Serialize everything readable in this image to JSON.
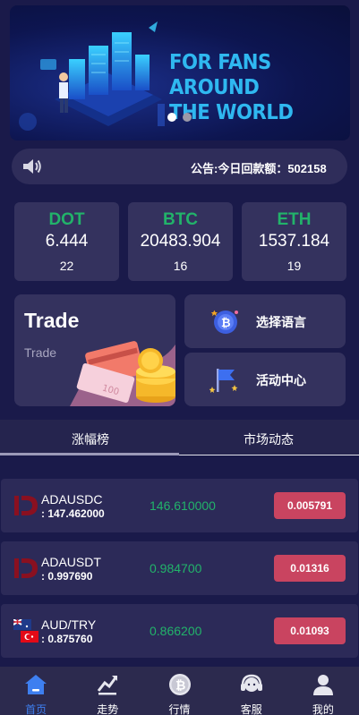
{
  "banner": {
    "title_line1": "FOR FANS AROUND",
    "title_line2": "THE WORLD",
    "slides": 2,
    "active_slide": 1
  },
  "notice": {
    "text": "公告:今日回款额：502158"
  },
  "tickers": [
    {
      "symbol": "DOT",
      "price": "6.444",
      "count": "22"
    },
    {
      "symbol": "BTC",
      "price": "20483.904",
      "count": "16"
    },
    {
      "symbol": "ETH",
      "price": "1537.184",
      "count": "19"
    }
  ],
  "trade": {
    "title": "Trade",
    "subtitle": "Trade"
  },
  "actions": {
    "language": "选择语言",
    "activity": "活动中心"
  },
  "tabs": {
    "gainers": "涨幅榜",
    "market": "市场动态"
  },
  "market_rows": [
    {
      "pair": "ADAUSDC",
      "volume": ": 147.462000",
      "price": "146.610000",
      "change": "0.005791",
      "logo": "cardano-d-logo-icon"
    },
    {
      "pair": "ADAUSDT",
      "volume": ": 0.997690",
      "price": "0.984700",
      "change": "0.01316",
      "logo": "cardano-d-logo-icon"
    },
    {
      "pair": "AUD/TRY",
      "volume": ": 0.875760",
      "price": "0.866200",
      "change": "0.01093",
      "logo": "aud-try-flags-icon"
    }
  ],
  "tabbar": {
    "home": "首页",
    "trend": "走势",
    "quotes": "行情",
    "service": "客服",
    "mine": "我的"
  },
  "colors": {
    "up_green": "#22b36a",
    "change_red": "#c94460",
    "active_blue": "#3e7ff0",
    "background": "#1a1a4a"
  }
}
